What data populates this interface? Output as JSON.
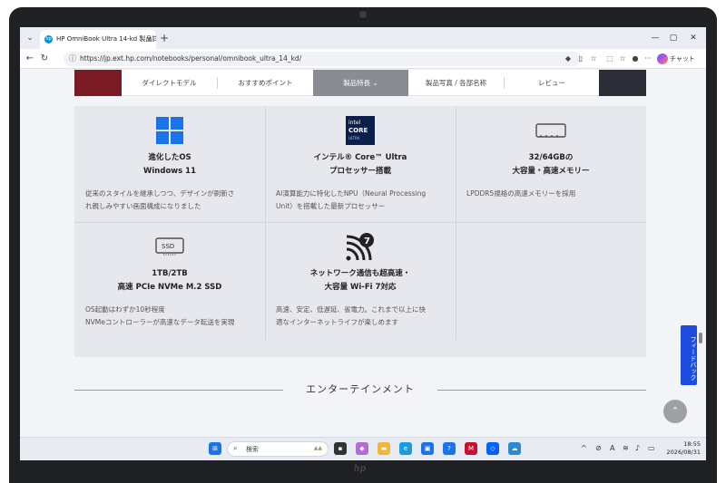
{
  "browser": {
    "tab_title": "HP OmniBook Ultra 14-kd 製品詳細",
    "new_tab_label": "+",
    "url": "https://jp.ext.hp.com/notebooks/personal/omnibook_ultra_14_kd/",
    "chat_label": "チャット",
    "window_controls": [
      "—",
      "▢",
      "✕"
    ]
  },
  "subnav": {
    "items": [
      {
        "label": "ダイレクトモデル",
        "active": false
      },
      {
        "label": "おすすめポイント",
        "active": false
      },
      {
        "label": "製品特長 ⌄",
        "active": true
      },
      {
        "label": "製品写真 / 各部名称",
        "active": false
      },
      {
        "label": "レビュー",
        "active": false
      }
    ]
  },
  "features": [
    {
      "icon": "windows-logo-icon",
      "title_line1": "進化したOS",
      "title_line2": "Windows 11",
      "desc_line1": "従来のスタイルを継承しつつ、デザインが刷新さ",
      "desc_line2": "れ親しみやすい画面構成になりました"
    },
    {
      "icon": "intel-core-ultra-badge",
      "badge_line1": "intel",
      "badge_line2": "CORE",
      "badge_line3": "ULTRA",
      "title_line1": "インテル® Core™ Ultra",
      "title_line2": "プロセッサー搭載",
      "desc_line1": "AI演算能力に特化したNPU（Neural Processing",
      "desc_line2": "Unit）を搭載した最新プロセッサー"
    },
    {
      "icon": "memory-icon",
      "title_line1": "32/64GBの",
      "title_line2": "大容量・高速メモリー",
      "desc_line1": "LPDDR5規格の高速メモリーを採用",
      "desc_line2": ""
    },
    {
      "icon": "ssd-icon",
      "icon_text": "SSD",
      "title_line1": "1TB/2TB",
      "title_line2": "高速 PCIe NVMe M.2 SSD",
      "desc_line1": "OS起動はわずか10秒程度",
      "desc_line2": "NVMeコントローラーが高速なデータ転送を実現"
    },
    {
      "icon": "wifi7-icon",
      "icon_text": "7",
      "title_line1": "ネットワーク通信も超高速・",
      "title_line2": "大容量 Wi-Fi 7対応",
      "desc_line1": "高速、安定、低遅延、省電力。これまで以上に快",
      "desc_line2": "適なインターネットライフが楽しめます"
    }
  ],
  "section": {
    "title": "エンターテインメント"
  },
  "feedback_label": "フィードバック",
  "taskbar": {
    "search_placeholder": "検索",
    "tray": {
      "chevron": "^",
      "ime": "A"
    },
    "clock": {
      "time": "18:55",
      "date": "2026/08/31"
    }
  },
  "colors": {
    "accent_blue": "#1d4de0",
    "nav_active": "#8a8c93",
    "windows_blue": "#1a73e8",
    "intel_navy": "#0b1f4a"
  }
}
